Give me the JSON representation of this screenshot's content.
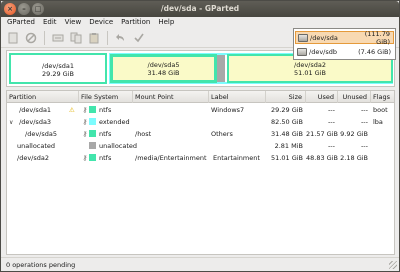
{
  "window": {
    "title": "/dev/sda - GParted"
  },
  "menu": [
    "GParted",
    "Edit",
    "View",
    "Device",
    "Partition",
    "Help"
  ],
  "toolbar": {
    "icons": [
      "new-icon",
      "delete-icon",
      "resize-icon",
      "copy-icon",
      "paste-icon",
      "undo-icon",
      "apply-icon"
    ]
  },
  "device_selector": {
    "devices": [
      {
        "name": "/dev/sda",
        "size": "(111.79 GiB)",
        "selected": true
      },
      {
        "name": "/dev/sdb",
        "size": "(7.46 GiB)",
        "selected": false
      }
    ]
  },
  "disk_map": {
    "partitions": [
      {
        "name": "/dev/sda1",
        "size": "29.29 GiB"
      },
      {
        "name": "/dev/sda5",
        "size": "31.48 GiB"
      },
      {
        "name": "/dev/sda2",
        "size": "51.01 GiB"
      }
    ]
  },
  "table": {
    "headers": [
      "Partition",
      "File System",
      "Mount Point",
      "Label",
      "Size",
      "Used",
      "Unused",
      "Flags"
    ],
    "rows": [
      {
        "partition": "/dev/sda1",
        "fs": "ntfs",
        "fs_color": "#42e5ac",
        "mount": "",
        "label": "Windows7",
        "size": "29.29 GiB",
        "used": "---",
        "unused": "---",
        "flags": "boot",
        "warning": true
      },
      {
        "partition": "/dev/sda3",
        "fs": "extended",
        "fs_color": "#7dfcfe",
        "mount": "",
        "label": "",
        "size": "82.50 GiB",
        "used": "---",
        "unused": "---",
        "flags": "lba",
        "expander": true
      },
      {
        "partition": "/dev/sda5",
        "fs": "ntfs",
        "fs_color": "#42e5ac",
        "mount": "/host",
        "label": "Others",
        "size": "31.48 GiB",
        "used": "21.57 GiB",
        "unused": "9.92 GiB",
        "flags": ""
      },
      {
        "partition": "unallocated",
        "fs": "unallocated",
        "fs_color": "#a8a8a8",
        "mount": "",
        "label": "",
        "size": "2.81 MiB",
        "used": "---",
        "unused": "---",
        "flags": ""
      },
      {
        "partition": "/dev/sda2",
        "fs": "ntfs",
        "fs_color": "#42e5ac",
        "mount": "/media/Entertainment",
        "label": "Entartainment",
        "size": "51.01 GiB",
        "used": "48.83 GiB",
        "unused": "2.18 GiB",
        "flags": ""
      }
    ]
  },
  "status": {
    "text": "0 operations pending"
  }
}
